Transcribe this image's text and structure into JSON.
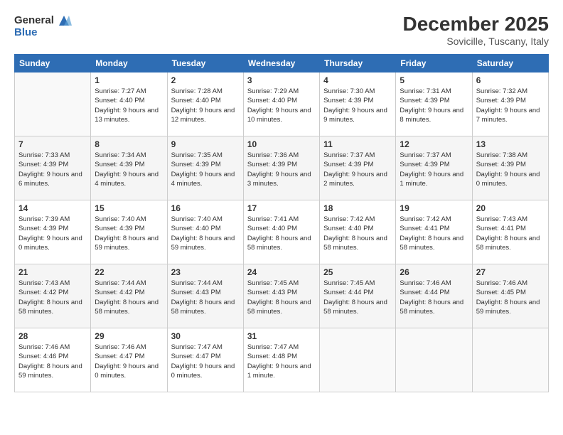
{
  "logo": {
    "line1": "General",
    "line2": "Blue"
  },
  "title": "December 2025",
  "subtitle": "Sovicille, Tuscany, Italy",
  "days_of_week": [
    "Sunday",
    "Monday",
    "Tuesday",
    "Wednesday",
    "Thursday",
    "Friday",
    "Saturday"
  ],
  "weeks": [
    [
      {
        "day": "",
        "sunrise": "",
        "sunset": "",
        "daylight": ""
      },
      {
        "day": "1",
        "sunrise": "Sunrise: 7:27 AM",
        "sunset": "Sunset: 4:40 PM",
        "daylight": "Daylight: 9 hours and 13 minutes."
      },
      {
        "day": "2",
        "sunrise": "Sunrise: 7:28 AM",
        "sunset": "Sunset: 4:40 PM",
        "daylight": "Daylight: 9 hours and 12 minutes."
      },
      {
        "day": "3",
        "sunrise": "Sunrise: 7:29 AM",
        "sunset": "Sunset: 4:40 PM",
        "daylight": "Daylight: 9 hours and 10 minutes."
      },
      {
        "day": "4",
        "sunrise": "Sunrise: 7:30 AM",
        "sunset": "Sunset: 4:39 PM",
        "daylight": "Daylight: 9 hours and 9 minutes."
      },
      {
        "day": "5",
        "sunrise": "Sunrise: 7:31 AM",
        "sunset": "Sunset: 4:39 PM",
        "daylight": "Daylight: 9 hours and 8 minutes."
      },
      {
        "day": "6",
        "sunrise": "Sunrise: 7:32 AM",
        "sunset": "Sunset: 4:39 PM",
        "daylight": "Daylight: 9 hours and 7 minutes."
      }
    ],
    [
      {
        "day": "7",
        "sunrise": "Sunrise: 7:33 AM",
        "sunset": "Sunset: 4:39 PM",
        "daylight": "Daylight: 9 hours and 6 minutes."
      },
      {
        "day": "8",
        "sunrise": "Sunrise: 7:34 AM",
        "sunset": "Sunset: 4:39 PM",
        "daylight": "Daylight: 9 hours and 4 minutes."
      },
      {
        "day": "9",
        "sunrise": "Sunrise: 7:35 AM",
        "sunset": "Sunset: 4:39 PM",
        "daylight": "Daylight: 9 hours and 4 minutes."
      },
      {
        "day": "10",
        "sunrise": "Sunrise: 7:36 AM",
        "sunset": "Sunset: 4:39 PM",
        "daylight": "Daylight: 9 hours and 3 minutes."
      },
      {
        "day": "11",
        "sunrise": "Sunrise: 7:37 AM",
        "sunset": "Sunset: 4:39 PM",
        "daylight": "Daylight: 9 hours and 2 minutes."
      },
      {
        "day": "12",
        "sunrise": "Sunrise: 7:37 AM",
        "sunset": "Sunset: 4:39 PM",
        "daylight": "Daylight: 9 hours and 1 minute."
      },
      {
        "day": "13",
        "sunrise": "Sunrise: 7:38 AM",
        "sunset": "Sunset: 4:39 PM",
        "daylight": "Daylight: 9 hours and 0 minutes."
      }
    ],
    [
      {
        "day": "14",
        "sunrise": "Sunrise: 7:39 AM",
        "sunset": "Sunset: 4:39 PM",
        "daylight": "Daylight: 9 hours and 0 minutes."
      },
      {
        "day": "15",
        "sunrise": "Sunrise: 7:40 AM",
        "sunset": "Sunset: 4:39 PM",
        "daylight": "Daylight: 8 hours and 59 minutes."
      },
      {
        "day": "16",
        "sunrise": "Sunrise: 7:40 AM",
        "sunset": "Sunset: 4:40 PM",
        "daylight": "Daylight: 8 hours and 59 minutes."
      },
      {
        "day": "17",
        "sunrise": "Sunrise: 7:41 AM",
        "sunset": "Sunset: 4:40 PM",
        "daylight": "Daylight: 8 hours and 58 minutes."
      },
      {
        "day": "18",
        "sunrise": "Sunrise: 7:42 AM",
        "sunset": "Sunset: 4:40 PM",
        "daylight": "Daylight: 8 hours and 58 minutes."
      },
      {
        "day": "19",
        "sunrise": "Sunrise: 7:42 AM",
        "sunset": "Sunset: 4:41 PM",
        "daylight": "Daylight: 8 hours and 58 minutes."
      },
      {
        "day": "20",
        "sunrise": "Sunrise: 7:43 AM",
        "sunset": "Sunset: 4:41 PM",
        "daylight": "Daylight: 8 hours and 58 minutes."
      }
    ],
    [
      {
        "day": "21",
        "sunrise": "Sunrise: 7:43 AM",
        "sunset": "Sunset: 4:42 PM",
        "daylight": "Daylight: 8 hours and 58 minutes."
      },
      {
        "day": "22",
        "sunrise": "Sunrise: 7:44 AM",
        "sunset": "Sunset: 4:42 PM",
        "daylight": "Daylight: 8 hours and 58 minutes."
      },
      {
        "day": "23",
        "sunrise": "Sunrise: 7:44 AM",
        "sunset": "Sunset: 4:43 PM",
        "daylight": "Daylight: 8 hours and 58 minutes."
      },
      {
        "day": "24",
        "sunrise": "Sunrise: 7:45 AM",
        "sunset": "Sunset: 4:43 PM",
        "daylight": "Daylight: 8 hours and 58 minutes."
      },
      {
        "day": "25",
        "sunrise": "Sunrise: 7:45 AM",
        "sunset": "Sunset: 4:44 PM",
        "daylight": "Daylight: 8 hours and 58 minutes."
      },
      {
        "day": "26",
        "sunrise": "Sunrise: 7:46 AM",
        "sunset": "Sunset: 4:44 PM",
        "daylight": "Daylight: 8 hours and 58 minutes."
      },
      {
        "day": "27",
        "sunrise": "Sunrise: 7:46 AM",
        "sunset": "Sunset: 4:45 PM",
        "daylight": "Daylight: 8 hours and 59 minutes."
      }
    ],
    [
      {
        "day": "28",
        "sunrise": "Sunrise: 7:46 AM",
        "sunset": "Sunset: 4:46 PM",
        "daylight": "Daylight: 8 hours and 59 minutes."
      },
      {
        "day": "29",
        "sunrise": "Sunrise: 7:46 AM",
        "sunset": "Sunset: 4:47 PM",
        "daylight": "Daylight: 9 hours and 0 minutes."
      },
      {
        "day": "30",
        "sunrise": "Sunrise: 7:47 AM",
        "sunset": "Sunset: 4:47 PM",
        "daylight": "Daylight: 9 hours and 0 minutes."
      },
      {
        "day": "31",
        "sunrise": "Sunrise: 7:47 AM",
        "sunset": "Sunset: 4:48 PM",
        "daylight": "Daylight: 9 hours and 1 minute."
      },
      {
        "day": "",
        "sunrise": "",
        "sunset": "",
        "daylight": ""
      },
      {
        "day": "",
        "sunrise": "",
        "sunset": "",
        "daylight": ""
      },
      {
        "day": "",
        "sunrise": "",
        "sunset": "",
        "daylight": ""
      }
    ]
  ]
}
